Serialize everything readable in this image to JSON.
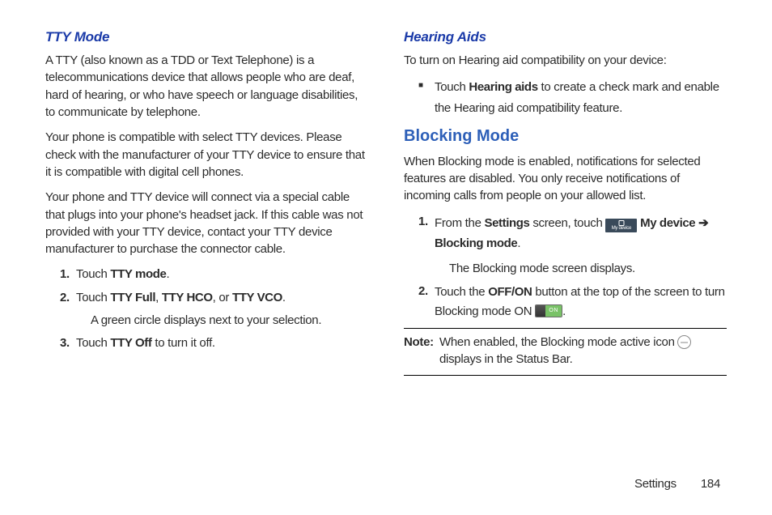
{
  "leftCol": {
    "ttyMode": {
      "heading": "TTY Mode",
      "p1": "A TTY (also known as a TDD or Text Telephone) is a telecommunications device that allows people who are deaf, hard of hearing, or who have speech or language disabilities, to communicate by telephone.",
      "p2": "Your phone is compatible with select TTY devices. Please check with the manufacturer of your TTY device to ensure that it is compatible with digital cell phones.",
      "p3": "Your phone and TTY device will connect via a special cable that plugs into your phone's headset jack. If this cable was not provided with your TTY device, contact your TTY device manufacturer to purchase the connector cable.",
      "step1": {
        "num": "1.",
        "pre": "Touch ",
        "b1": "TTY mode",
        "post": "."
      },
      "step2": {
        "num": "2.",
        "pre": "Touch ",
        "b1": "TTY Full",
        "c1": ", ",
        "b2": "TTY HCO",
        "c2": ", or ",
        "b3": "TTY VCO",
        "post": "."
      },
      "step2sub": "A green circle displays next to your selection.",
      "step3": {
        "num": "3.",
        "pre": "Touch ",
        "b1": "TTY Off",
        "post": " to turn it off."
      }
    }
  },
  "rightCol": {
    "hearingAids": {
      "heading": "Hearing Aids",
      "p1": "To turn on Hearing aid compatibility on your device:",
      "bullet1": {
        "pre": "Touch ",
        "b1": "Hearing aids",
        "post": " to create a check mark and enable the Hearing aid compatibility feature."
      }
    },
    "blockingMode": {
      "heading": "Blocking Mode",
      "p1": "When Blocking mode is enabled, notifications for selected features are disabled. You only receive notifications of incoming calls from people on your allowed list.",
      "step1": {
        "num": "1.",
        "pre": "From the ",
        "b1": "Settings",
        "mid": " screen, touch ",
        "iconText": "My device",
        "b2": " My device",
        "arrow": " ➔ ",
        "b3": "Blocking mode",
        "post": "."
      },
      "step1sub": "The Blocking mode screen displays.",
      "step2": {
        "num": "2.",
        "pre": "Touch the ",
        "b1": "OFF/ON",
        "mid": " button at the top of the screen to turn Blocking mode ON ",
        "switchLabel": "ON",
        "post": "."
      },
      "note": {
        "label": "Note: ",
        "pre": "When enabled, the Blocking mode active icon ",
        "post": " displays in the Status Bar."
      }
    }
  },
  "footer": {
    "section": "Settings",
    "page": "184"
  }
}
